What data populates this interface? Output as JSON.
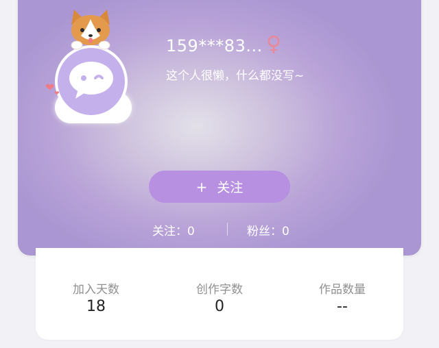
{
  "profile": {
    "username": "159***83...",
    "gender_symbol": "♀",
    "bio": "这个人很懒，什么都没写~"
  },
  "follow": {
    "plus": "+",
    "label": "关注"
  },
  "counts": {
    "following": "关注：0",
    "fans": "粉丝：0"
  },
  "stats": [
    {
      "label": "加入天数",
      "value": "18"
    },
    {
      "label": "创作字数",
      "value": "0"
    },
    {
      "label": "作品数量",
      "value": "--"
    }
  ],
  "colors": {
    "header_purple": "#a996d2",
    "button_purple": "#b890e2",
    "gender_pink": "#e88a98"
  },
  "icons": {
    "avatar": "corgi-on-chat-bubble",
    "gender": "female-icon"
  }
}
